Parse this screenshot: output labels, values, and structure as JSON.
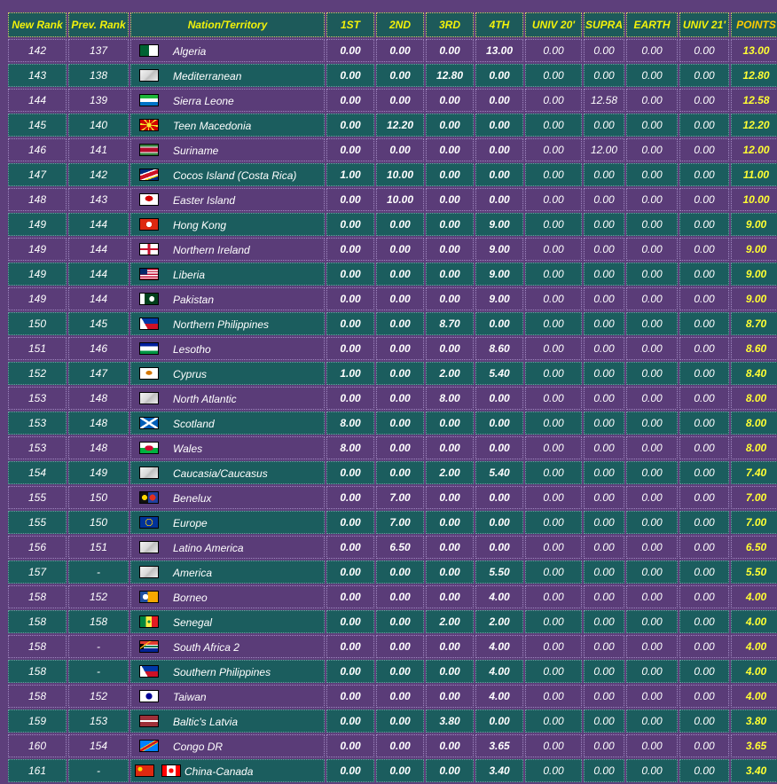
{
  "headers": [
    "New Rank",
    "Prev. Rank",
    "Nation/Territory",
    "1ST",
    "2ND",
    "3RD",
    "4TH",
    "UNIV 20'",
    "SUPRA",
    "EARTH",
    "UNIV 21'",
    "POINTS"
  ],
  "rows": [
    {
      "new": "142",
      "prev": "137",
      "name": "Algeria",
      "flags": [
        "algeria-flag"
      ],
      "v": [
        "0.00",
        "0.00",
        "0.00",
        "13.00",
        "0.00",
        "0.00",
        "0.00",
        "0.00"
      ],
      "points": "13.00"
    },
    {
      "new": "143",
      "prev": "138",
      "name": "Mediterranean",
      "flags": [
        "generic-flag"
      ],
      "v": [
        "0.00",
        "0.00",
        "12.80",
        "0.00",
        "0.00",
        "0.00",
        "0.00",
        "0.00"
      ],
      "points": "12.80"
    },
    {
      "new": "144",
      "prev": "139",
      "name": "Sierra Leone",
      "flags": [
        "sierra-leone-flag"
      ],
      "v": [
        "0.00",
        "0.00",
        "0.00",
        "0.00",
        "0.00",
        "12.58",
        "0.00",
        "0.00"
      ],
      "points": "12.58"
    },
    {
      "new": "145",
      "prev": "140",
      "name": "Teen Macedonia",
      "flags": [
        "macedonia-flag"
      ],
      "v": [
        "0.00",
        "12.20",
        "0.00",
        "0.00",
        "0.00",
        "0.00",
        "0.00",
        "0.00"
      ],
      "points": "12.20"
    },
    {
      "new": "146",
      "prev": "141",
      "name": "Suriname",
      "flags": [
        "suriname-flag"
      ],
      "v": [
        "0.00",
        "0.00",
        "0.00",
        "0.00",
        "0.00",
        "12.00",
        "0.00",
        "0.00"
      ],
      "points": "12.00"
    },
    {
      "new": "147",
      "prev": "142",
      "name": "Cocos Island (Costa Rica)",
      "flags": [
        "cocos-flag"
      ],
      "v": [
        "1.00",
        "10.00",
        "0.00",
        "0.00",
        "0.00",
        "0.00",
        "0.00",
        "0.00"
      ],
      "points": "11.00"
    },
    {
      "new": "148",
      "prev": "143",
      "name": "Easter Island",
      "flags": [
        "easter-island-flag"
      ],
      "v": [
        "0.00",
        "10.00",
        "0.00",
        "0.00",
        "0.00",
        "0.00",
        "0.00",
        "0.00"
      ],
      "points": "10.00"
    },
    {
      "new": "149",
      "prev": "144",
      "name": "Hong Kong",
      "flags": [
        "hong-kong-flag"
      ],
      "v": [
        "0.00",
        "0.00",
        "0.00",
        "9.00",
        "0.00",
        "0.00",
        "0.00",
        "0.00"
      ],
      "points": "9.00"
    },
    {
      "new": "149",
      "prev": "144",
      "name": "Northern Ireland",
      "flags": [
        "northern-ireland-flag"
      ],
      "v": [
        "0.00",
        "0.00",
        "0.00",
        "9.00",
        "0.00",
        "0.00",
        "0.00",
        "0.00"
      ],
      "points": "9.00"
    },
    {
      "new": "149",
      "prev": "144",
      "name": "Liberia",
      "flags": [
        "liberia-flag"
      ],
      "v": [
        "0.00",
        "0.00",
        "0.00",
        "9.00",
        "0.00",
        "0.00",
        "0.00",
        "0.00"
      ],
      "points": "9.00"
    },
    {
      "new": "149",
      "prev": "144",
      "name": "Pakistan",
      "flags": [
        "pakistan-flag"
      ],
      "v": [
        "0.00",
        "0.00",
        "0.00",
        "9.00",
        "0.00",
        "0.00",
        "0.00",
        "0.00"
      ],
      "points": "9.00"
    },
    {
      "new": "150",
      "prev": "145",
      "name": "Northern Philippines",
      "flags": [
        "philippines-flag"
      ],
      "v": [
        "0.00",
        "0.00",
        "8.70",
        "0.00",
        "0.00",
        "0.00",
        "0.00",
        "0.00"
      ],
      "points": "8.70"
    },
    {
      "new": "151",
      "prev": "146",
      "name": "Lesotho",
      "flags": [
        "lesotho-flag"
      ],
      "v": [
        "0.00",
        "0.00",
        "0.00",
        "8.60",
        "0.00",
        "0.00",
        "0.00",
        "0.00"
      ],
      "points": "8.60"
    },
    {
      "new": "152",
      "prev": "147",
      "name": "Cyprus",
      "flags": [
        "cyprus-flag"
      ],
      "v": [
        "1.00",
        "0.00",
        "2.00",
        "5.40",
        "0.00",
        "0.00",
        "0.00",
        "0.00"
      ],
      "points": "8.40"
    },
    {
      "new": "153",
      "prev": "148",
      "name": "North Atlantic",
      "flags": [
        "generic-flag"
      ],
      "v": [
        "0.00",
        "0.00",
        "8.00",
        "0.00",
        "0.00",
        "0.00",
        "0.00",
        "0.00"
      ],
      "points": "8.00"
    },
    {
      "new": "153",
      "prev": "148",
      "name": "Scotland",
      "flags": [
        "scotland-flag"
      ],
      "v": [
        "8.00",
        "0.00",
        "0.00",
        "0.00",
        "0.00",
        "0.00",
        "0.00",
        "0.00"
      ],
      "points": "8.00"
    },
    {
      "new": "153",
      "prev": "148",
      "name": "Wales",
      "flags": [
        "wales-flag"
      ],
      "v": [
        "8.00",
        "0.00",
        "0.00",
        "0.00",
        "0.00",
        "0.00",
        "0.00",
        "0.00"
      ],
      "points": "8.00"
    },
    {
      "new": "154",
      "prev": "149",
      "name": "Caucasia/Caucasus",
      "flags": [
        "generic-flag"
      ],
      "v": [
        "0.00",
        "0.00",
        "2.00",
        "5.40",
        "0.00",
        "0.00",
        "0.00",
        "0.00"
      ],
      "points": "7.40"
    },
    {
      "new": "155",
      "prev": "150",
      "name": "Benelux",
      "flags": [
        "benelux-flag"
      ],
      "v": [
        "0.00",
        "7.00",
        "0.00",
        "0.00",
        "0.00",
        "0.00",
        "0.00",
        "0.00"
      ],
      "points": "7.00"
    },
    {
      "new": "155",
      "prev": "150",
      "name": "Europe",
      "flags": [
        "europe-flag"
      ],
      "v": [
        "0.00",
        "7.00",
        "0.00",
        "0.00",
        "0.00",
        "0.00",
        "0.00",
        "0.00"
      ],
      "points": "7.00"
    },
    {
      "new": "156",
      "prev": "151",
      "name": "Latino America",
      "flags": [
        "generic-flag"
      ],
      "v": [
        "0.00",
        "6.50",
        "0.00",
        "0.00",
        "0.00",
        "0.00",
        "0.00",
        "0.00"
      ],
      "points": "6.50"
    },
    {
      "new": "157",
      "prev": "-",
      "name": "America",
      "flags": [
        "generic-flag"
      ],
      "v": [
        "0.00",
        "0.00",
        "0.00",
        "5.50",
        "0.00",
        "0.00",
        "0.00",
        "0.00"
      ],
      "points": "5.50"
    },
    {
      "new": "158",
      "prev": "152",
      "name": "Borneo",
      "flags": [
        "borneo-flag"
      ],
      "v": [
        "0.00",
        "0.00",
        "0.00",
        "4.00",
        "0.00",
        "0.00",
        "0.00",
        "0.00"
      ],
      "points": "4.00"
    },
    {
      "new": "158",
      "prev": "158",
      "name": "Senegal",
      "flags": [
        "senegal-flag"
      ],
      "v": [
        "0.00",
        "0.00",
        "2.00",
        "2.00",
        "0.00",
        "0.00",
        "0.00",
        "0.00"
      ],
      "points": "4.00"
    },
    {
      "new": "158",
      "prev": "-",
      "name": "South Africa 2",
      "flags": [
        "south-africa-flag"
      ],
      "v": [
        "0.00",
        "0.00",
        "0.00",
        "4.00",
        "0.00",
        "0.00",
        "0.00",
        "0.00"
      ],
      "points": "4.00"
    },
    {
      "new": "158",
      "prev": "-",
      "name": "Southern Philippines",
      "flags": [
        "philippines-flag"
      ],
      "v": [
        "0.00",
        "0.00",
        "0.00",
        "4.00",
        "0.00",
        "0.00",
        "0.00",
        "0.00"
      ],
      "points": "4.00"
    },
    {
      "new": "158",
      "prev": "152",
      "name": "Taiwan",
      "flags": [
        "taiwan-flag"
      ],
      "v": [
        "0.00",
        "0.00",
        "0.00",
        "4.00",
        "0.00",
        "0.00",
        "0.00",
        "0.00"
      ],
      "points": "4.00"
    },
    {
      "new": "159",
      "prev": "153",
      "name": "Baltic's Latvia",
      "flags": [
        "latvia-flag"
      ],
      "v": [
        "0.00",
        "0.00",
        "3.80",
        "0.00",
        "0.00",
        "0.00",
        "0.00",
        "0.00"
      ],
      "points": "3.80"
    },
    {
      "new": "160",
      "prev": "154",
      "name": "Congo DR",
      "flags": [
        "congo-dr-flag"
      ],
      "v": [
        "0.00",
        "0.00",
        "0.00",
        "3.65",
        "0.00",
        "0.00",
        "0.00",
        "0.00"
      ],
      "points": "3.65"
    },
    {
      "new": "161",
      "prev": "-",
      "name": "China-Canada",
      "flags": [
        "china-flag",
        "canada-flag"
      ],
      "v": [
        "0.00",
        "0.00",
        "0.00",
        "3.40",
        "0.00",
        "0.00",
        "0.00",
        "0.00"
      ],
      "points": "3.40"
    }
  ]
}
